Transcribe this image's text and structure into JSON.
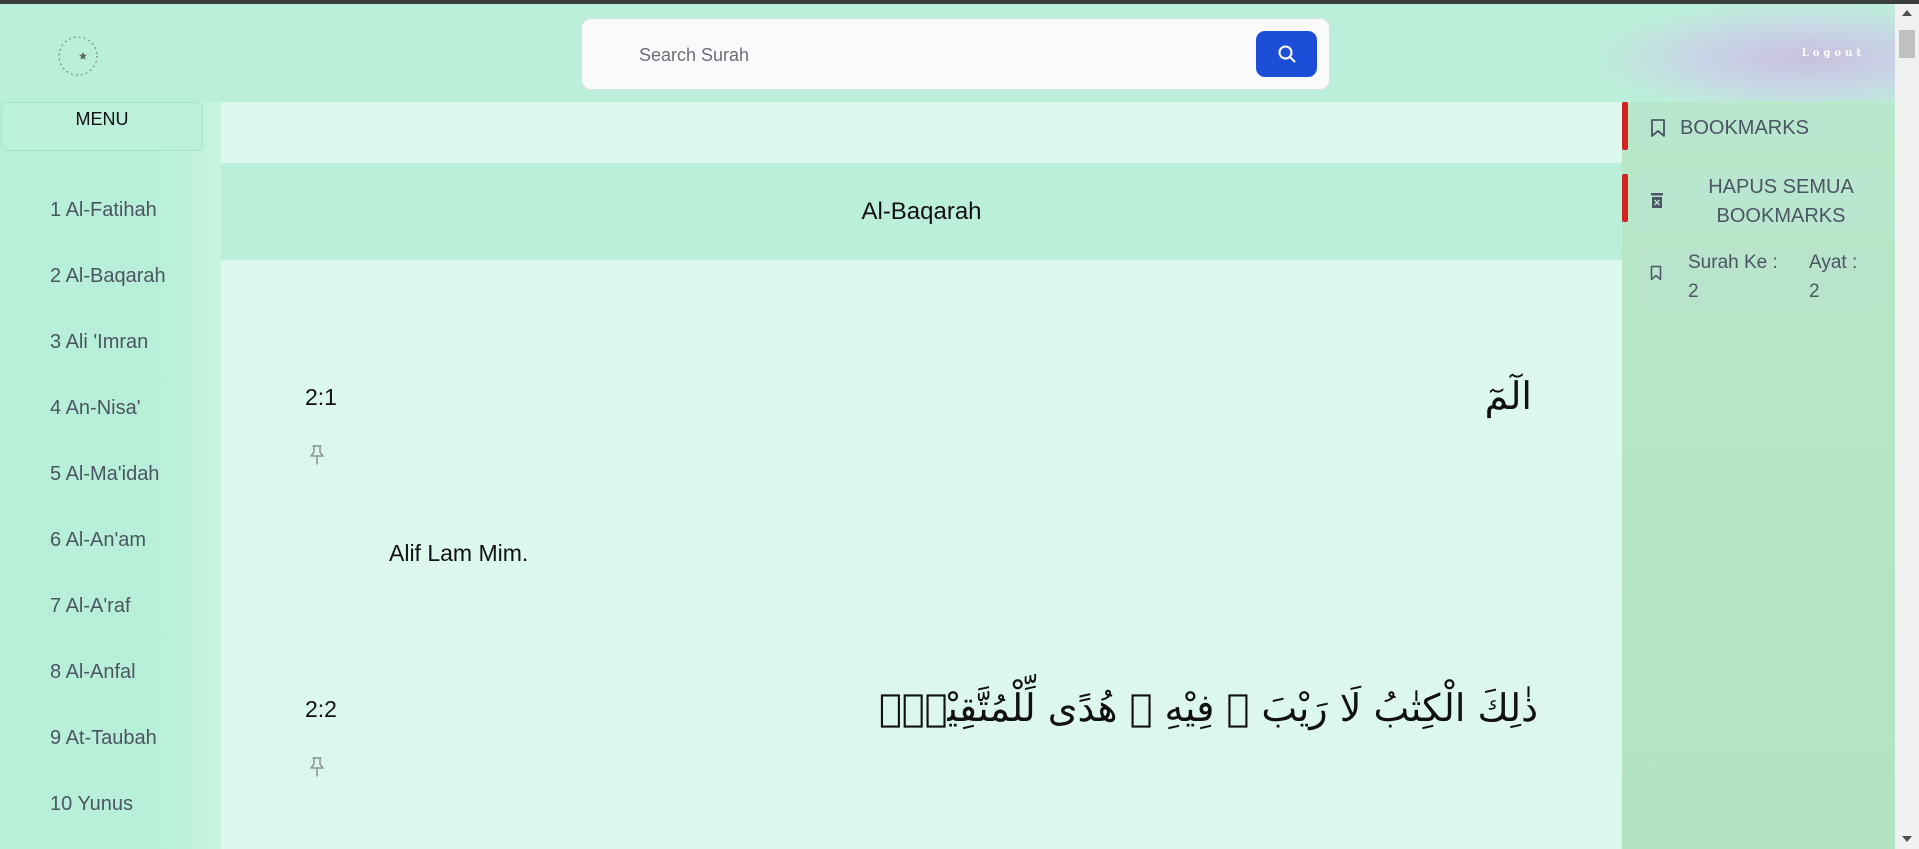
{
  "header": {
    "search_placeholder": "Search Surah",
    "logout_label": "Logout"
  },
  "sidebar": {
    "menu_label": "MENU",
    "surahs": [
      "1 Al-Fatihah",
      "2 Al-Baqarah",
      "3 Ali 'Imran",
      "4 An-Nisa'",
      "5 Al-Ma'idah",
      "6 Al-An'am",
      "7 Al-A'raf",
      "8 Al-Anfal",
      "9 At-Taubah",
      "10 Yunus"
    ]
  },
  "main": {
    "surah_title": "Al-Baqarah",
    "ayahs": [
      {
        "number": "2:1",
        "arabic": "الٓمٓ",
        "translation": "Alif Lam Mim."
      },
      {
        "number": "2:2",
        "arabic": "ذٰلِكَ الْكِتٰبُ لَا رَيْبَ ۛ فِيْهِ ۛ هُدًى لِّلْمُتَّقِيْنَۙ",
        "translation": ""
      }
    ]
  },
  "bookmarks_panel": {
    "bookmarks_label": "BOOKMARKS",
    "delete_all_label": "HAPUS SEMUA BOOKMARKS",
    "items": [
      {
        "surah_label": "Surah Ke :",
        "surah_value": "2",
        "ayah_label": "Ayat :",
        "ayah_value": "2"
      }
    ]
  },
  "colors": {
    "background": "#b9efd9",
    "content_bg": "#dcf7ec",
    "accent_blue": "#1d4ed8",
    "accent_red": "#d32222"
  },
  "icons": [
    "logo-icon",
    "search-icon",
    "pin-icon",
    "bookmark-icon",
    "trash-icon"
  ]
}
